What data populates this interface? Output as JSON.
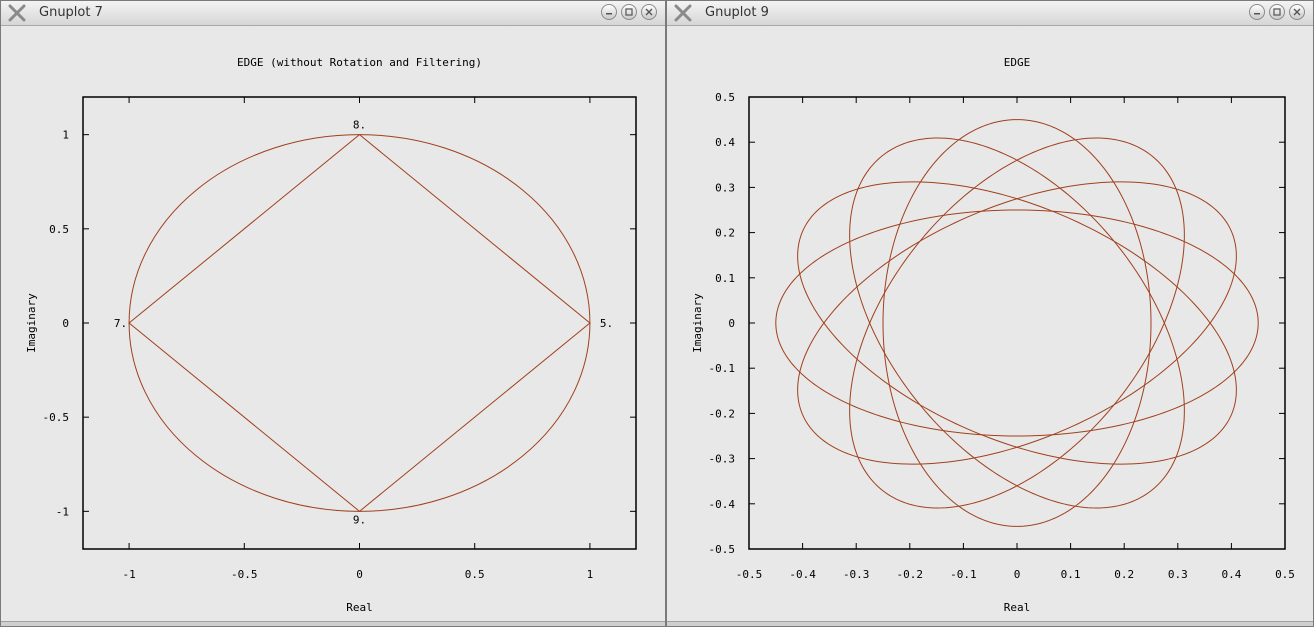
{
  "windows": [
    {
      "title": "Gnuplot 7",
      "minimize_label": "minimize",
      "maximize_label": "maximize",
      "close_label": "close"
    },
    {
      "title": "Gnuplot 9",
      "minimize_label": "minimize",
      "maximize_label": "maximize",
      "close_label": "close"
    }
  ],
  "colors": {
    "series": "#a0401c",
    "axis": "#000000",
    "background": "#e8e8e8"
  },
  "chart_data": [
    {
      "type": "line",
      "title": "EDGE (without Rotation and Filtering)",
      "xlabel": "Real",
      "ylabel": "Imaginary",
      "xlim": [
        -1.2,
        1.2
      ],
      "ylim": [
        -1.2,
        1.2
      ],
      "xticks": [
        -1,
        -0.5,
        0,
        0.5,
        1
      ],
      "xtick_labels": [
        "-1",
        "-0.5",
        "0",
        "0.5",
        "1"
      ],
      "yticks": [
        -1,
        -0.5,
        0,
        0.5,
        1
      ],
      "ytick_labels": [
        "-1",
        "-0.5",
        "0",
        "0.5",
        "1"
      ],
      "grid": false,
      "series": [
        {
          "kind": "circle",
          "cx": 0,
          "cy": 0,
          "r": 1
        },
        {
          "kind": "polyline",
          "x": [
            0,
            1,
            0,
            -1,
            0
          ],
          "y": [
            1,
            0,
            -1,
            0,
            1
          ]
        }
      ],
      "point_labels": [
        {
          "x": 0,
          "y": 1,
          "text": "8."
        },
        {
          "x": 1,
          "y": 0,
          "text": "5."
        },
        {
          "x": 0,
          "y": -1,
          "text": "9."
        },
        {
          "x": -1,
          "y": 0,
          "text": "7."
        }
      ]
    },
    {
      "type": "line",
      "title": "EDGE",
      "xlabel": "Real",
      "ylabel": "Imaginary",
      "xlim": [
        -0.5,
        0.5
      ],
      "ylim": [
        -0.5,
        0.5
      ],
      "xticks": [
        -0.5,
        -0.4,
        -0.3,
        -0.2,
        -0.1,
        0,
        0.1,
        0.2,
        0.3,
        0.4,
        0.5
      ],
      "xtick_labels": [
        "-0.5",
        "-0.4",
        "-0.3",
        "-0.2",
        "-0.1",
        "0",
        "0.1",
        "0.2",
        "0.3",
        "0.4",
        "0.5"
      ],
      "yticks": [
        -0.5,
        -0.4,
        -0.3,
        -0.2,
        -0.1,
        0,
        0.1,
        0.2,
        0.3,
        0.4,
        0.5
      ],
      "ytick_labels": [
        "-0.5",
        "-0.4",
        "-0.3",
        "-0.2",
        "-0.1",
        "0",
        "0.1",
        "0.2",
        "0.3",
        "0.4",
        "0.5"
      ],
      "grid": false,
      "series": [
        {
          "kind": "rotated_ellipses",
          "count": 6,
          "semi_major": 0.45,
          "semi_minor": 0.25,
          "rotation_step_deg": 30
        }
      ],
      "point_labels": []
    }
  ]
}
